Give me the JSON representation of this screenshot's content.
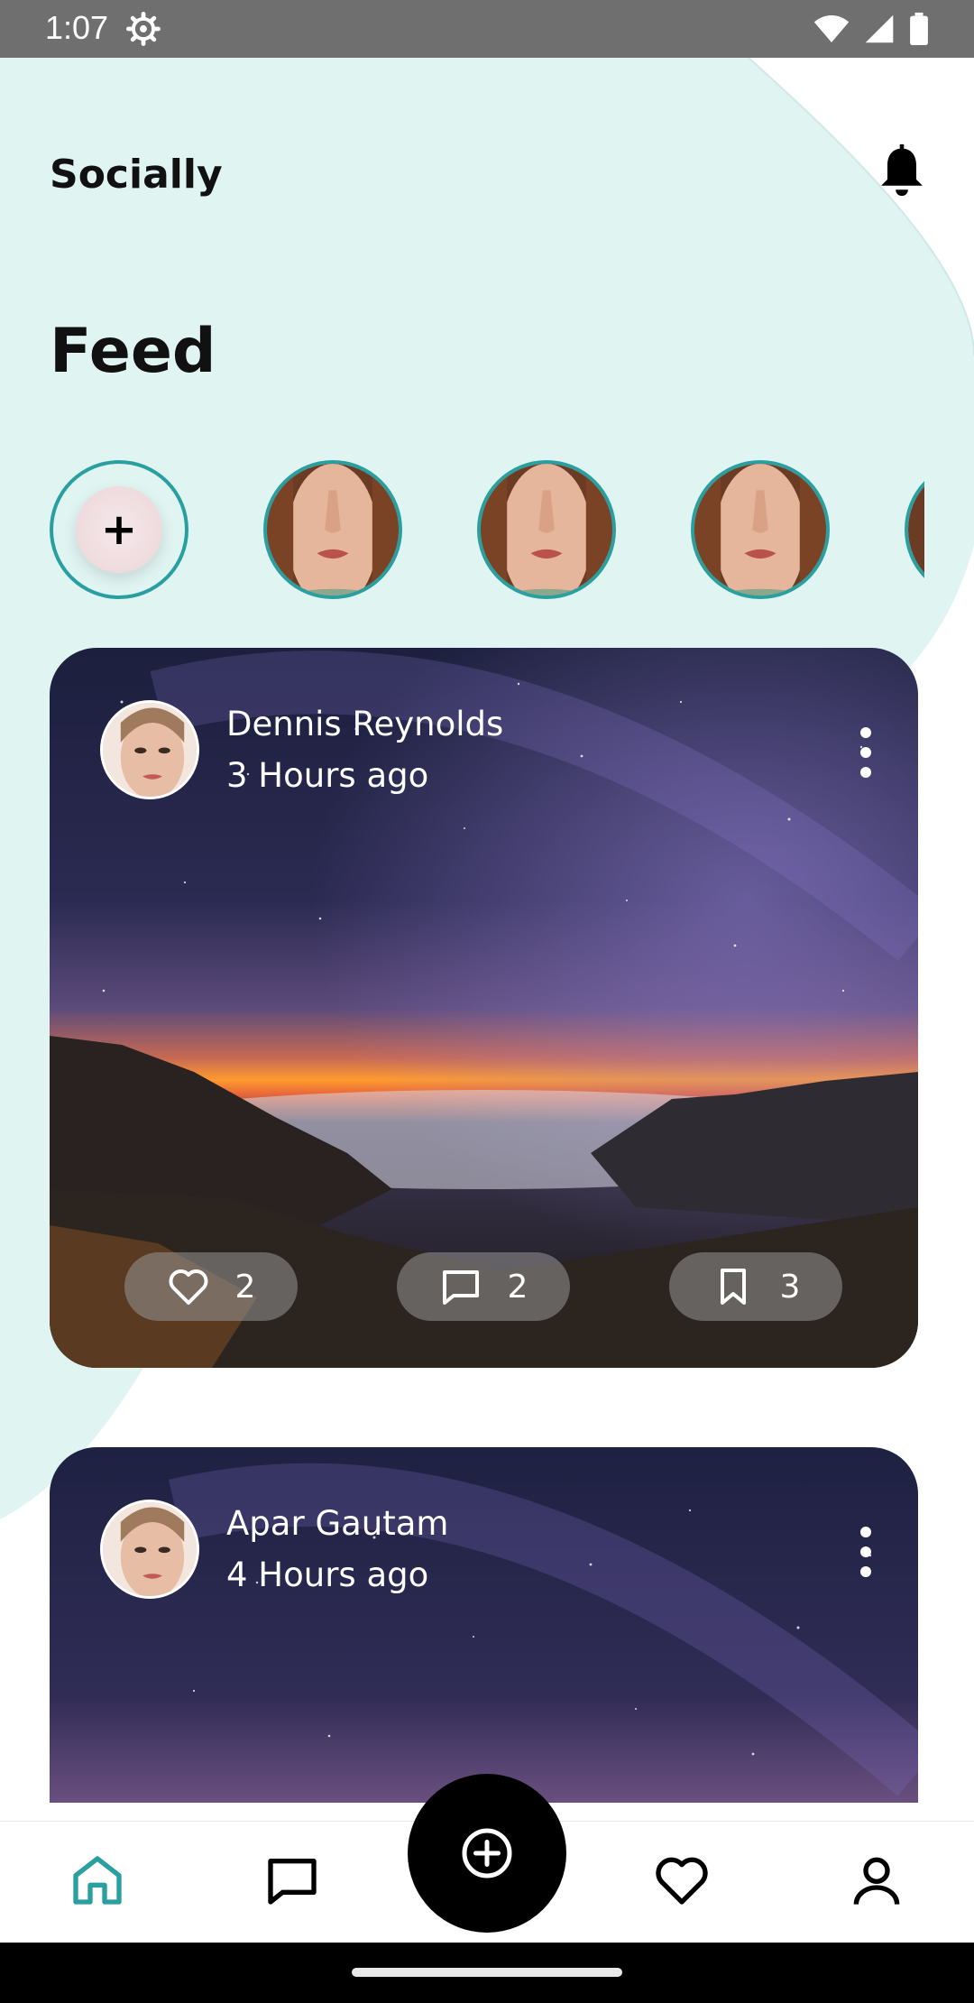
{
  "status_bar": {
    "time": "1:07"
  },
  "header": {
    "app_title": "Socially",
    "page_title": "Feed"
  },
  "stories": {
    "add_label": "+"
  },
  "posts": [
    {
      "author": "Dennis Reynolds",
      "time": "3 Hours ago",
      "likes": "2",
      "comments": "2",
      "saves": "3"
    },
    {
      "author": "Apar Gautam",
      "time": "4 Hours ago"
    }
  ],
  "bottom_nav": {
    "items": [
      "home-icon",
      "chat-icon",
      "add-circle-icon",
      "heart-icon",
      "profile-icon"
    ],
    "active": "home"
  },
  "colors": {
    "accent": "#2a9fa0",
    "background_blob": "#e0f4f2"
  }
}
